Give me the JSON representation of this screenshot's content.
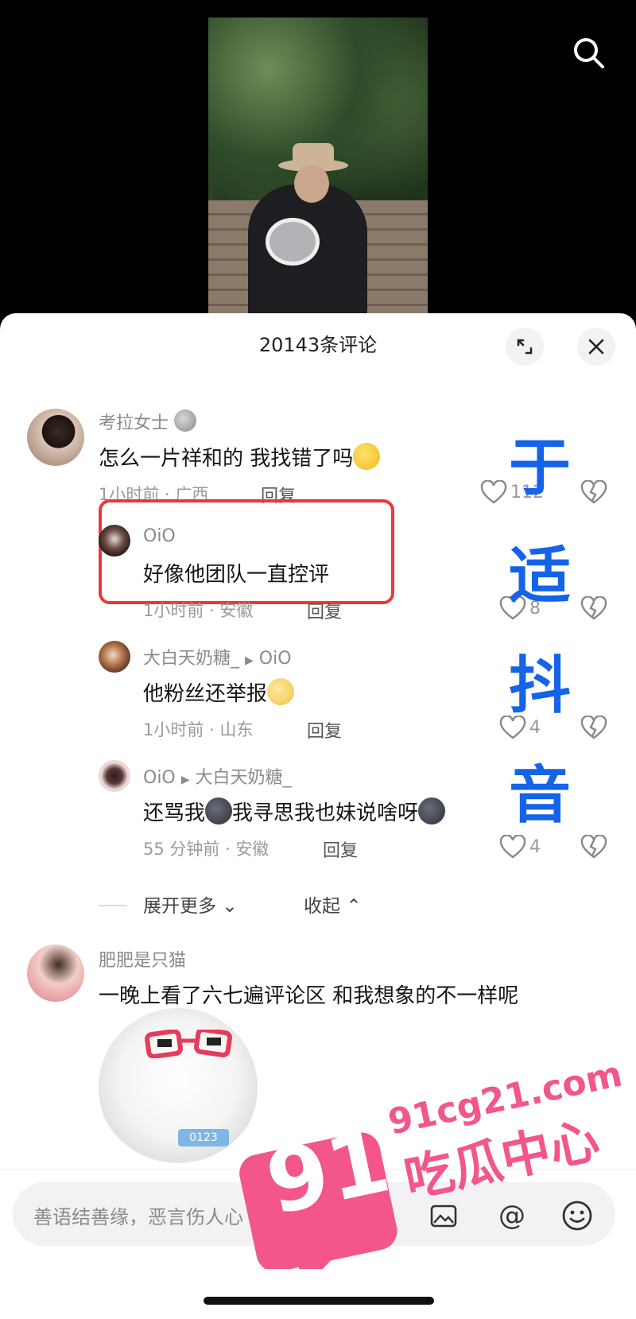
{
  "header": {
    "search_icon": "search-icon"
  },
  "sheet": {
    "title": "20143条评论",
    "expand_icon": "expand-icon",
    "close_icon": "close-icon"
  },
  "comments": [
    {
      "user": "考拉女士",
      "text": "怎么一片祥和的 我找错了吗",
      "meta": "1小时前 · 广西",
      "reply": "回复",
      "likes": "112"
    },
    {
      "user": "OiO",
      "text": "好像他团队一直控评",
      "meta": "1小时前 · 安徽",
      "reply": "回复",
      "likes": "8"
    },
    {
      "user": "大白天奶糖_",
      "reply_to": "OiO",
      "text": "他粉丝还举报",
      "meta": "1小时前 · 山东",
      "reply": "回复",
      "likes": "4"
    },
    {
      "user": "OiO",
      "reply_to": "大白天奶糖_",
      "text1": "还骂我",
      "text2": "我寻思我也妹说啥呀",
      "meta": "55 分钟前 · 安徽",
      "reply": "回复",
      "likes": "4"
    },
    {
      "user": "肥肥是只猫",
      "text": "一晚上看了六七遍评论区 和我想象的不一样呢"
    }
  ],
  "thread": {
    "expand_more": "展开更多",
    "collapse": "收起"
  },
  "watermark": {
    "chars": [
      "于",
      "适",
      "抖",
      "音"
    ]
  },
  "sticker_label": "0123",
  "input": {
    "placeholder": "善语结善缘，恶言伤人心"
  },
  "logo": {
    "number": "91",
    "domain": "91cg21.com",
    "name": "吃瓜中心",
    "color": "#f2568b"
  }
}
